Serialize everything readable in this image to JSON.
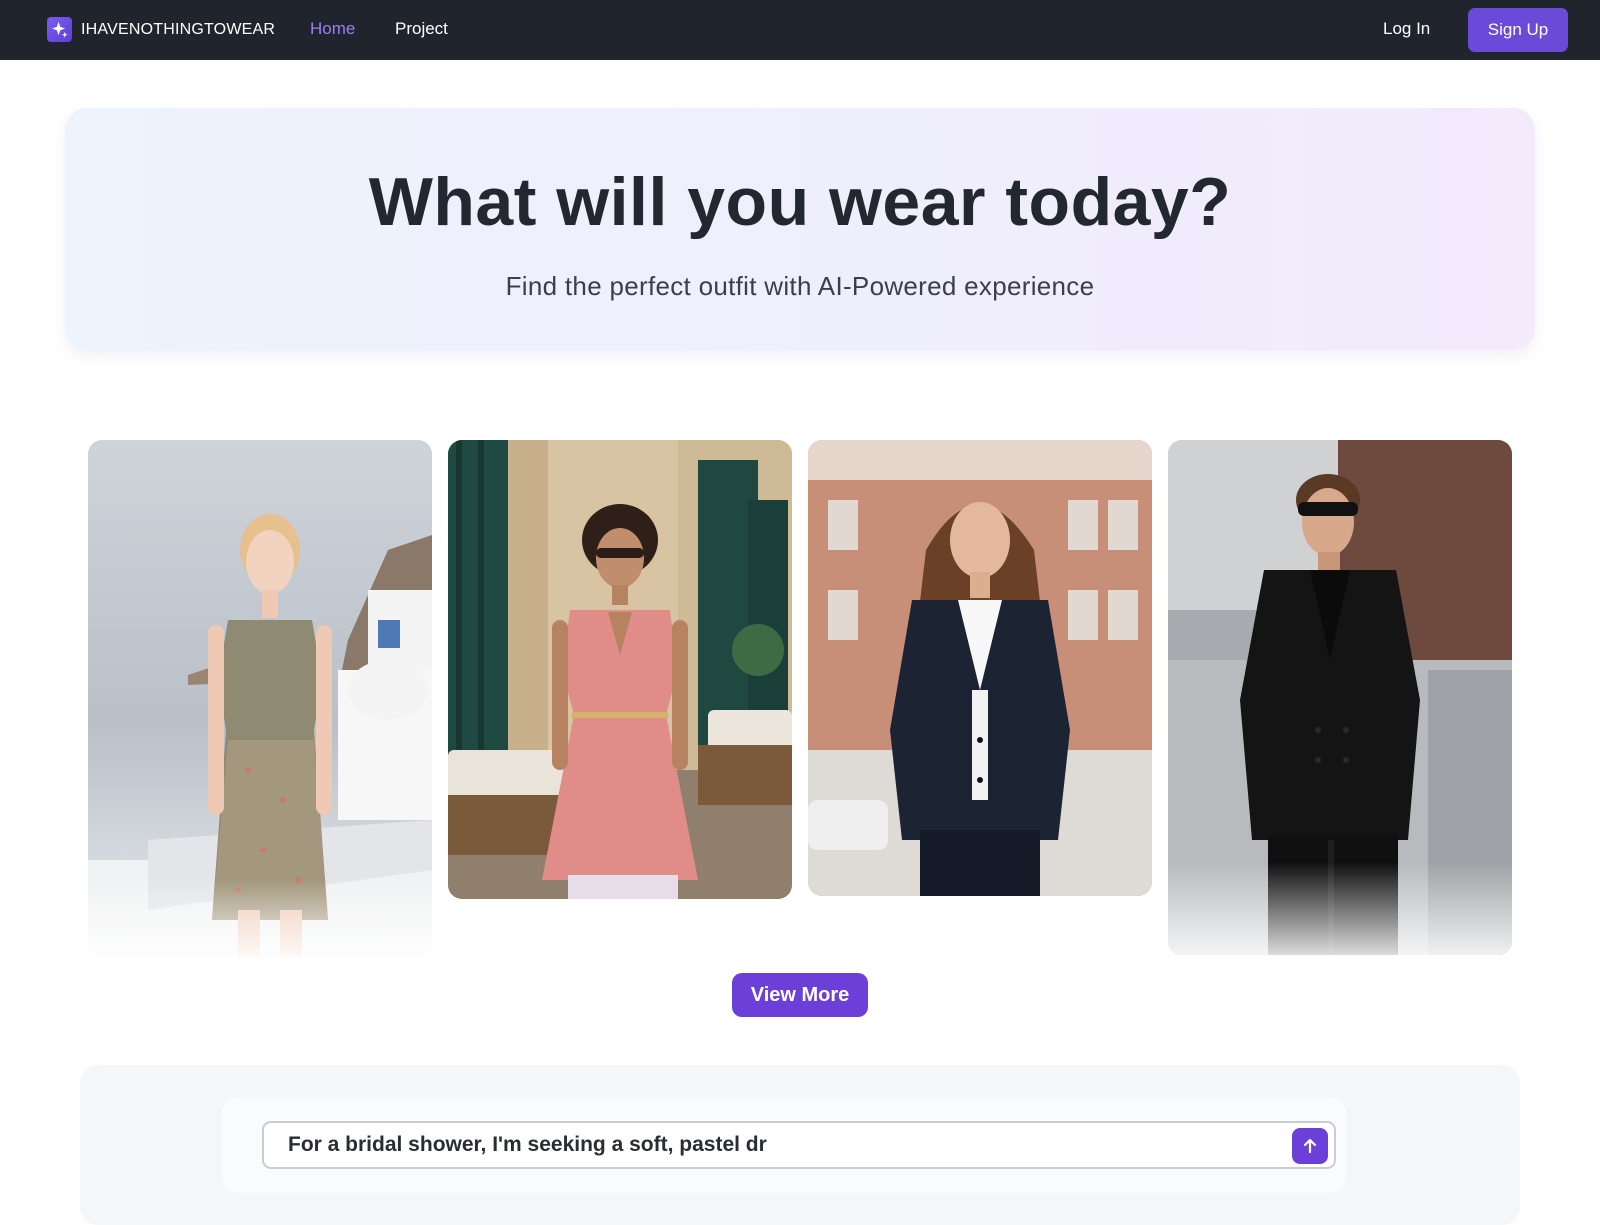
{
  "navbar": {
    "brand_name": "IHAVENOTHINGTOWEAR",
    "brand_icon": "sparkle-icon",
    "links": [
      {
        "label": "Home",
        "active": true
      },
      {
        "label": "Project",
        "active": false
      }
    ],
    "login_label": "Log In",
    "signup_label": "Sign Up"
  },
  "hero": {
    "title": "What will you wear today?",
    "subtitle": "Find the perfect outfit with AI-Powered experience"
  },
  "gallery": {
    "cards": [
      {
        "subject": "woman in floral sundress on coastal terrace"
      },
      {
        "subject": "woman in pink dress with sunglasses"
      },
      {
        "subject": "woman in navy blazer and white shirt"
      },
      {
        "subject": "man in black double-breasted suit with sunglasses"
      }
    ],
    "view_more_label": "View More"
  },
  "prompt": {
    "value": "For a bridal shower, I'm seeking a soft, pastel dr",
    "send_icon": "arrow-up-icon"
  },
  "colors": {
    "accent": "#6c40d8",
    "nav_bg": "#20242c",
    "active_link": "#9b7ff3"
  }
}
